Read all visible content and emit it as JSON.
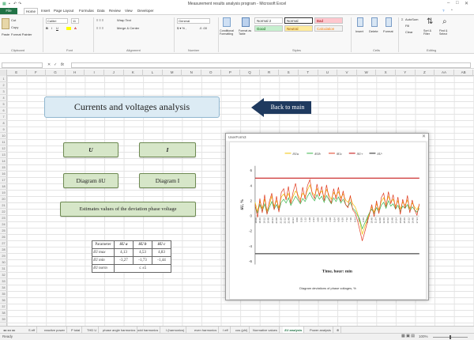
{
  "window": {
    "title": "Measurement results analysis program - Microsoft Excel"
  },
  "ribbon": {
    "tabs": [
      "File",
      "Home",
      "Insert",
      "Page Layout",
      "Formulas",
      "Data",
      "Review",
      "View",
      "Developer"
    ],
    "clipboard": {
      "cut": "Cut",
      "copy": "Copy",
      "paste": "Paste",
      "format_painter": "Format Painter",
      "label": "Clipboard"
    },
    "font": {
      "name": "Calibri",
      "size": "11",
      "label": "Font"
    },
    "alignment": {
      "wrap": "Wrap Text",
      "merge": "Merge & Center",
      "label": "Alignment"
    },
    "number": {
      "format": "General",
      "label": "Number"
    },
    "styles": {
      "conditional": "Conditional Formatting",
      "format_table": "Format as Table",
      "normal2": "Normal 2",
      "normal": "Normal",
      "bad": "Bad",
      "good": "Good",
      "neutral": "Neutral",
      "calculation": "Calculation",
      "label": "Styles"
    },
    "cells": {
      "insert": "Insert",
      "delete": "Delete",
      "format": "Format",
      "label": "Cells"
    },
    "editing": {
      "autosum": "AutoSum",
      "fill": "Fill",
      "clear": "Clear",
      "sort": "Sort & Filter",
      "find": "Find & Select",
      "label": "Editing"
    }
  },
  "formula_bar": {
    "fx": "fx",
    "value": ""
  },
  "columns": [
    "E",
    "F",
    "G",
    "H",
    "I",
    "J",
    "K",
    "L",
    "M",
    "N",
    "O",
    "P",
    "Q",
    "R",
    "S",
    "T",
    "U",
    "V",
    "W",
    "X",
    "Y",
    "Z",
    "AA",
    "AB"
  ],
  "rows": [
    "1",
    "2",
    "3",
    "4",
    "5",
    "6",
    "7",
    "8",
    "9",
    "10",
    "11",
    "12",
    "13",
    "14",
    "15",
    "16",
    "17",
    "18",
    "19",
    "20",
    "21",
    "22",
    "23",
    "24",
    "25",
    "26",
    "27",
    "28",
    "29",
    "30",
    "31",
    "32",
    "33",
    "34",
    "35",
    "36",
    "37",
    "38",
    "39"
  ],
  "sheet": {
    "title": "Currents and voltages analysis",
    "back_button": "Back to main",
    "buttons": {
      "u": "U",
      "i": "I",
      "diagram_u": "Diagram δU",
      "diagram_i": "Diagram I",
      "estimates": "Estimates values of the deviation phase voltage"
    },
    "table": {
      "headers": [
        "Parameter",
        "δU a",
        "δU b",
        "δU c"
      ],
      "rows": [
        [
          "δU max",
          "4,13",
          "4,53",
          "4,83"
        ],
        [
          "δU min",
          "-3,27",
          "-1,73",
          "-1,44"
        ],
        [
          "δU norm",
          "≤ ±5"
        ]
      ]
    }
  },
  "userform": {
    "title": "UserForm3",
    "close": "✕",
    "chart_caption": "Diagram deviations of phase voltages, %"
  },
  "chart_data": {
    "type": "line",
    "title": "",
    "xlabel": "Time, hour: min",
    "ylabel": "δU, %",
    "ylim": [
      -6,
      6
    ],
    "yticks": [
      "6",
      "4",
      "2",
      "0",
      "-2",
      "-4",
      "-6"
    ],
    "reference_lines": {
      "upper": 5,
      "lower": -5
    },
    "legend": [
      "δUa",
      "δUb",
      "δUc",
      "δU+",
      "δU-"
    ],
    "legend_position": "top",
    "xtick_labels": [
      "18:00",
      "18:36",
      "19:12",
      "19:48",
      "20:24",
      "21:00",
      "21:36",
      "22:12",
      "22:48",
      "23:24",
      "0:00",
      "0:36",
      "1:12",
      "1:48",
      "2:24",
      "3:00",
      "3:36",
      "4:12",
      "4:48",
      "5:24",
      "6:00",
      "6:36",
      "7:12",
      "7:48",
      "8:24",
      "9:00",
      "9:36",
      "10:12",
      "10:48",
      "11:24",
      "12:00",
      "12:36",
      "13:12",
      "13:48",
      "14:24",
      "15:00",
      "15:36",
      "16:12",
      "16:48",
      "17:24"
    ],
    "series": [
      {
        "name": "δUa",
        "color": "#f2c200",
        "values": [
          1.8,
          0.6,
          1.9,
          1.0,
          2.2,
          0.7,
          1.5,
          2.6,
          1.3,
          2.0,
          1.1,
          2.5,
          2.9,
          2.3,
          3.0,
          1.9,
          2.6,
          3.3,
          2.8,
          2.2,
          3.0,
          2.6,
          3.4,
          4.1,
          3.1,
          2.7,
          3.6,
          2.9,
          3.3,
          2.5,
          3.5,
          2.8,
          2.2,
          3.1,
          2.6,
          3.2,
          2.4,
          2.9,
          2.1,
          1.8,
          2.5,
          1.6,
          1.2,
          0.4,
          -0.8,
          -2.4,
          -1.5,
          -0.6,
          0.3,
          1.2,
          0.5,
          1.6,
          0.8,
          1.9,
          2.4,
          1.5,
          2.6,
          1.8,
          2.2,
          1.3,
          2.0,
          0.9,
          1.8,
          1.4,
          2.1,
          1.0,
          1.7,
          1.2,
          0.8,
          1.5
        ]
      },
      {
        "name": "δUb",
        "color": "#3bb54a",
        "values": [
          1.2,
          0.4,
          1.5,
          0.6,
          1.6,
          0.3,
          1.1,
          1.9,
          0.9,
          1.5,
          0.7,
          1.8,
          2.2,
          1.7,
          2.4,
          1.4,
          2.0,
          2.6,
          2.1,
          1.6,
          2.3,
          1.9,
          2.6,
          3.1,
          2.4,
          2.0,
          2.8,
          2.2,
          2.6,
          1.8,
          2.7,
          2.1,
          1.6,
          2.4,
          1.9,
          2.5,
          1.7,
          2.2,
          1.5,
          1.2,
          1.8,
          1.0,
          0.7,
          0.1,
          -0.5,
          -1.7,
          -1.0,
          -0.3,
          0.4,
          0.9,
          0.3,
          1.1,
          0.5,
          1.4,
          1.8,
          1.0,
          2.0,
          1.3,
          1.6,
          0.9,
          1.4,
          0.6,
          1.3,
          1.0,
          1.5,
          0.6,
          1.2,
          0.8,
          0.5,
          1.0
        ]
      },
      {
        "name": "δUc",
        "color": "#e03a1e",
        "values": [
          1.5,
          -0.2,
          2.3,
          0.4,
          2.8,
          0.2,
          1.9,
          3.0,
          0.8,
          2.6,
          0.5,
          3.1,
          3.6,
          2.1,
          3.9,
          1.6,
          3.2,
          4.3,
          2.5,
          1.8,
          3.8,
          2.2,
          4.0,
          4.8,
          2.9,
          2.3,
          4.2,
          2.6,
          3.9,
          2.0,
          4.1,
          2.4,
          1.7,
          3.6,
          2.2,
          3.8,
          1.9,
          3.3,
          1.5,
          1.1,
          2.7,
          0.8,
          0.4,
          -0.6,
          -1.9,
          -3.3,
          -2.2,
          -1.0,
          0.1,
          1.5,
          -0.1,
          2.0,
          0.3,
          2.4,
          3.0,
          1.2,
          3.2,
          1.6,
          2.8,
          0.9,
          2.5,
          0.2,
          2.2,
          1.0,
          2.7,
          0.4,
          2.1,
          0.8,
          0.1,
          1.6
        ]
      },
      {
        "name": "δU+",
        "color": "#c00000",
        "values": "constant:5"
      },
      {
        "name": "δU-",
        "color": "#222222",
        "values": "constant:-5"
      }
    ]
  },
  "sheet_tabs": [
    "S eff",
    "reactive power",
    "P total",
    "THD U",
    "phase angle harmonics",
    "odd harmonics",
    "I (harmonics)",
    "even harmonics",
    "I eff",
    "cos (phi)",
    "Normative values",
    "δU analysis",
    "Power analysis"
  ],
  "active_sheet_tab": "δU analysis",
  "status": {
    "left": "Ready",
    "zoom": "100%"
  }
}
